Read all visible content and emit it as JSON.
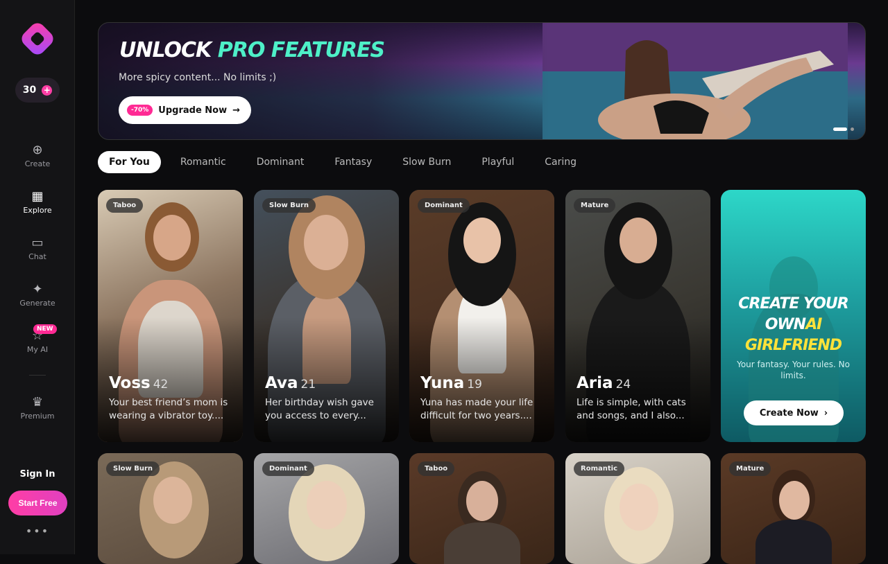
{
  "sidebar": {
    "credits": "30",
    "items": [
      {
        "label": "Create"
      },
      {
        "label": "Explore"
      },
      {
        "label": "Chat"
      },
      {
        "label": "Generate"
      },
      {
        "label": "My AI"
      },
      {
        "label": "Premium"
      }
    ],
    "new_badge": "NEW",
    "signin": "Sign In",
    "start_free": "Start Free"
  },
  "banner": {
    "headline_1": "UNLOCK",
    "headline_2": "PRO FEATURES",
    "subtitle": "More spicy content... No limits ;)",
    "discount": "-70%",
    "button": "Upgrade Now"
  },
  "tabs": [
    "For You",
    "Romantic",
    "Dominant",
    "Fantasy",
    "Slow Burn",
    "Playful",
    "Caring"
  ],
  "cards": [
    {
      "tag": "Taboo",
      "name": "Voss",
      "age": "42",
      "desc": "Your best friend’s mom is wearing a vibrator toy...."
    },
    {
      "tag": "Slow Burn",
      "name": "Ava",
      "age": "21",
      "desc": "Her birthday wish gave you access to every..."
    },
    {
      "tag": "Dominant",
      "name": "Yuna",
      "age": "19",
      "desc": "Yuna has made your life difficult for two years...."
    },
    {
      "tag": "Mature",
      "name": "Aria",
      "age": "24",
      "desc": "Life is simple, with cats and songs, and I also..."
    }
  ],
  "promo": {
    "line1": "CREATE YOUR",
    "line2a": "OWN",
    "line2b": "AI",
    "line3": "GIRLFRIEND",
    "subtitle": "Your fantasy. Your rules. No limits.",
    "button": "Create Now"
  },
  "row2_tags": [
    "Slow Burn",
    "Dominant",
    "Taboo",
    "Romantic",
    "Mature"
  ]
}
